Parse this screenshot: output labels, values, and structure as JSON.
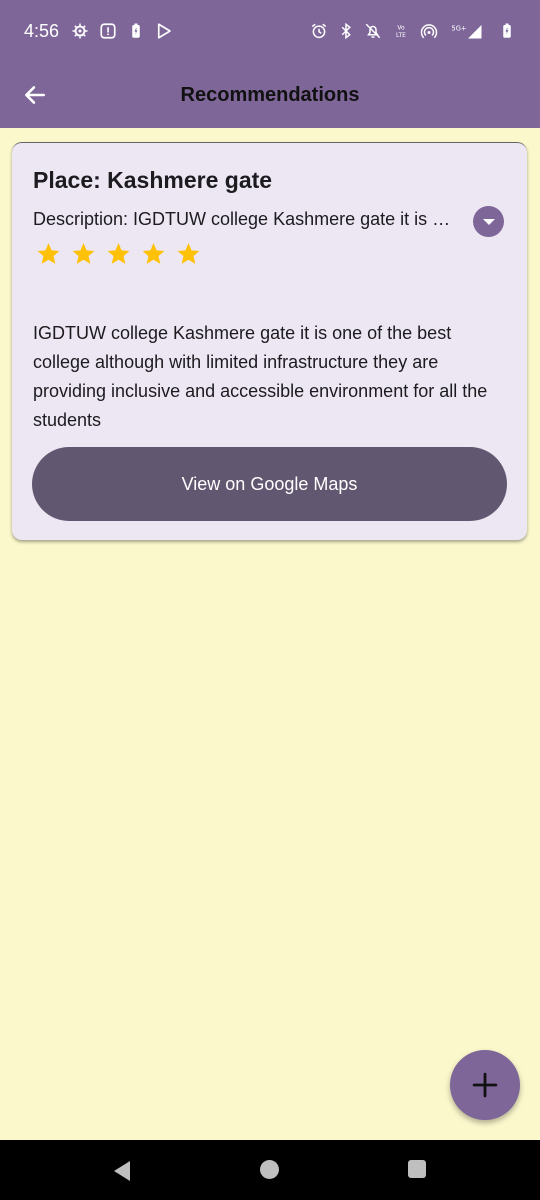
{
  "status_bar": {
    "time": "4:56",
    "left_icons": [
      "settings-icon",
      "notification-box-icon",
      "battery-saver-icon",
      "play-store-icon"
    ],
    "right_icons": [
      "alarm-icon",
      "bluetooth-icon",
      "mute-icon",
      "volte-icon",
      "hotspot-icon",
      "5g-signal-icon",
      "battery-icon"
    ],
    "volte_text": "Vo LTE",
    "network_text": "5G+"
  },
  "app_bar": {
    "title": "Recommendations",
    "back_icon": "arrow-back-icon"
  },
  "card": {
    "place": "Place: Kashmere gate",
    "description": "Description: IGDTUW college Kashmere gate it is one of the best college although with limited infrastructure they are providing inclusive and accessible environment for all the students",
    "rating": 5,
    "rating_max": 5,
    "review": "IGDTUW college Kashmere gate it is one of the best college although with limited infrastructure they are providing inclusive and accessible environment for all the students",
    "maps_button_label": "View on Google Maps",
    "expand_icon": "chevron-down-icon"
  },
  "fab": {
    "icon": "plus-icon"
  },
  "colors": {
    "primary": "#7E6699",
    "background": "#FBF8CC",
    "card": "#EDE7F3",
    "button": "#625771",
    "star": "#FFC107"
  }
}
